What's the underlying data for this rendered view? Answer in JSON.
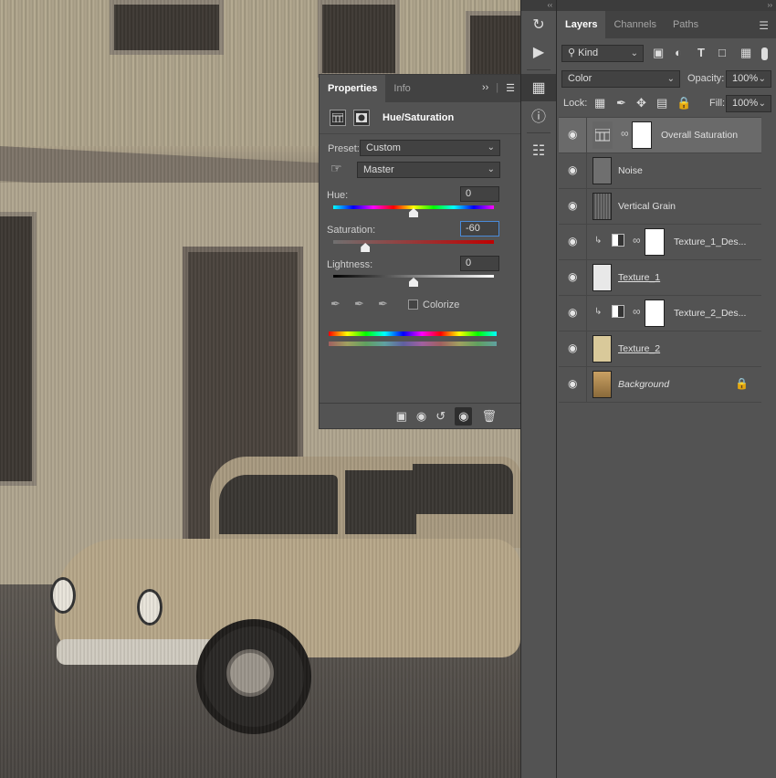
{
  "properties": {
    "tabs": [
      "Properties",
      "Info"
    ],
    "collapse_icon": "double-chevron",
    "menu_icon": "hamburger",
    "adjustment_title": "Hue/Saturation",
    "preset_label": "Preset:",
    "preset_value": "Custom",
    "channel_value": "Master",
    "hue_label": "Hue:",
    "hue_value": "0",
    "hue_position": 0.5,
    "saturation_label": "Saturation:",
    "saturation_value": "-60",
    "saturation_position": 0.2,
    "lightness_label": "Lightness:",
    "lightness_value": "0",
    "lightness_position": 0.5,
    "colorize_label": "Colorize",
    "colorize_checked": false,
    "footer_icons": [
      "clip-to-layer",
      "view-previous",
      "reset",
      "toggle-visibility",
      "delete"
    ]
  },
  "layers_panel": {
    "tabs": [
      "Layers",
      "Channels",
      "Paths"
    ],
    "filter_kind": "Kind",
    "blend_mode": "Color",
    "opacity_label": "Opacity:",
    "opacity_value": "100%",
    "lock_label": "Lock:",
    "fill_label": "Fill:",
    "fill_value": "100%",
    "layers": [
      {
        "name": "Overall Saturation",
        "selected": true,
        "style": "adjustment"
      },
      {
        "name": "Noise"
      },
      {
        "name": "Vertical Grain"
      },
      {
        "name": "Texture_1_Des..."
      },
      {
        "name": "Texture_1"
      },
      {
        "name": "Texture_2_Des..."
      },
      {
        "name": "Texture_2"
      },
      {
        "name": "Background",
        "locked": true
      }
    ]
  },
  "colors": {
    "panel_bg": "#535353",
    "tab_bg": "#424242",
    "selected_layer": "#6a6a6a",
    "focus_border": "#4a8ad8"
  }
}
